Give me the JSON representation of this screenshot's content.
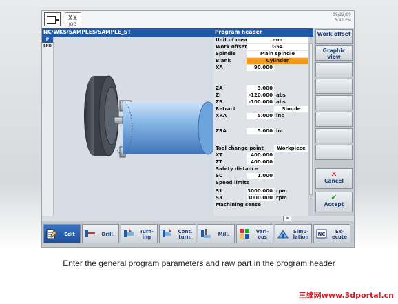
{
  "datetime": {
    "date": "09/22/09",
    "time": "3:42 PM"
  },
  "path": "NC/WKS/SAMPLES/SAMPLE_ST",
  "form_title": "Program header",
  "program_list": {
    "active": "P",
    "end": "END"
  },
  "form": {
    "unit_label": "Unit of measu",
    "unit_value": "mm",
    "workoffset_label": "Work offset",
    "workoffset_value": "G54",
    "spindle_label": "Spindle",
    "spindle_value": "Main spindle",
    "blank_label": "Blank",
    "blank_value": "Cylinder",
    "xa_label": "XA",
    "xa_value": "90.000",
    "za_label": "ZA",
    "za_value": "3.000",
    "zi_label": "ZI",
    "zi_value": "-120.000",
    "zi_unit": "abs",
    "zb_label": "ZB",
    "zb_value": "-100.000",
    "zb_unit": "abs",
    "retract_label": "Retract",
    "retract_value": "Simple",
    "xra_label": "XRA",
    "xra_value": "5.000",
    "xra_unit": "inc",
    "zra_label": "ZRA",
    "zra_value": "5.000",
    "zra_unit": "inc",
    "toolchange_label": "Tool change point",
    "toolchange_value": "Workpiece",
    "xt_label": "XT",
    "xt_value": "400.000",
    "zt_label": "ZT",
    "zt_value": "400.000",
    "safety_label": "Safety distance",
    "sc_label": "SC",
    "sc_value": "1.000",
    "speed_label": "Speed limits",
    "s1_label": "S1",
    "s1_value": "3000.000",
    "s1_unit": "rpm",
    "s3_label": "S3",
    "s3_value": "3000.000",
    "s3_unit": "rpm",
    "machining_label": "Machining sense"
  },
  "vsoftkeys": {
    "work_offset": "Work offset",
    "graphic_view": "Graphic view",
    "cancel": "Cancel",
    "accept": "Accept"
  },
  "hsoftkeys": {
    "edit": "Edit",
    "drill": "Drill.",
    "turning": "Turn-ing",
    "cont_turn": "Cont. turn.",
    "mill": "Mill.",
    "various": "Vari-ous",
    "simulation": "Simu-lation",
    "execute": "Ex-ecute"
  },
  "caption": "Enter the general program parameters and raw part in the program header",
  "watermark": "三维网www.3dportal.cn",
  "colors": {
    "header_blue": "#1e5aa8",
    "highlight_orange": "#f29a1d",
    "part_blue": "#7fb2e5"
  }
}
